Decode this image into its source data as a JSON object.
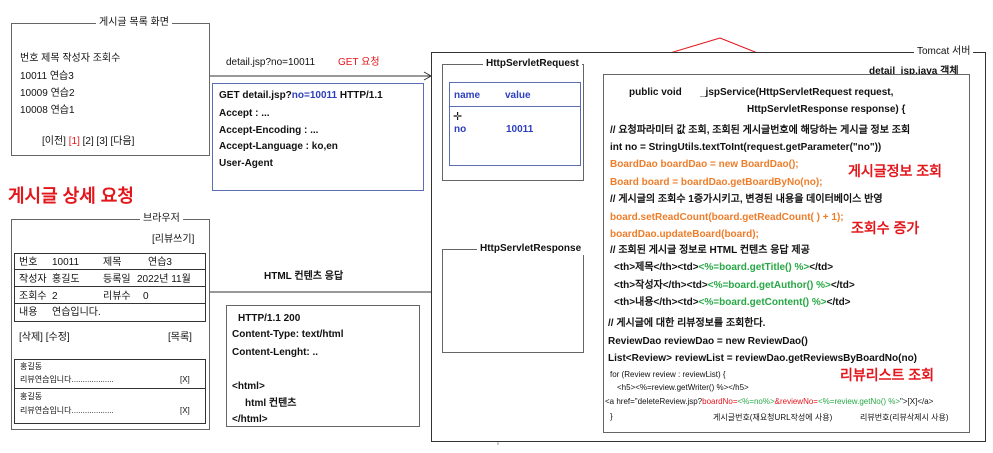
{
  "list_screen": {
    "title": "게시글 목록 화면",
    "header": "번호      제목  작성자  조회수",
    "rows": [
      "10011  연습3",
      "10009  연습2",
      "10008  연습1"
    ],
    "pager_prev": "[이전]",
    "pager_page1": "[1]",
    "pager_rest": "[2] [3] [다음]"
  },
  "request_url": "detail.jsp?no=10011",
  "get_request_label": "GET 요청",
  "detail_request_label": "게시글 상세 요청",
  "http_request_box": {
    "line1_prefix": "GET detail.jsp?",
    "line1_param": "no=10011",
    "line1_suffix": " HTTP/1.1",
    "accept": "Accept : ...",
    "accept_encoding": "Accept-Encoding : ...",
    "accept_language": "Accept-Language : ko,en",
    "user_agent": "User-Agent"
  },
  "browser": {
    "title": "브라우저",
    "write_review": "[리뷰쓰기]",
    "no_label": "번호",
    "no_value": "10011",
    "title_label": "제목",
    "title_value": "연습3",
    "writer_label": "작성자",
    "writer_value": "홍길도",
    "date_label": "등록일",
    "date_value": "2022년 11월",
    "views_label": "조회수",
    "views_value": "2",
    "reviews_label": "리뷰수",
    "reviews_value": "0",
    "content_label": "내용",
    "content_value": "연습입니다.",
    "delete_edit": "[삭제] [수정]",
    "list_link": "[목록]",
    "reviews": [
      {
        "author": "홍길동",
        "text": "리뷰연습입니다...................",
        "close": "[X]"
      },
      {
        "author": "홍길동",
        "text": "리뷰연습입니다...................",
        "close": "[X]"
      }
    ]
  },
  "html_response_label": "HTML 컨텐츠 응답",
  "http_response_box": {
    "status": "HTTP/1.1   200",
    "content_type": "Content-Type: text/html",
    "content_length": "Content-Lenght: ..",
    "html_open": "<html>",
    "html_content": "html 컨텐츠",
    "html_close": "</html>"
  },
  "tomcat": {
    "title": "Tomcat 서버",
    "object_label": "detail_jsp.java  객체"
  },
  "http_servlet_request": {
    "title": "HttpServletRequest",
    "col_name": "name",
    "col_value": "value",
    "param_name": "no",
    "param_value": "10011"
  },
  "http_servlet_response": {
    "title": "HttpServletResponse"
  },
  "code": {
    "l1a": "public void",
    "l1b": "_jspService(HttpServletRequest request,",
    "l2": "HttpServletResponse response) {",
    "c1": "// 요청파라미터 값 조회, 조회된 게시글번호에 해당하는 게시글 정보 조회",
    "l3": "int no = StringUtils.textToInt(request.getParameter(\"no\"))",
    "l4": "BoardDao boardDao = new BoardDao();",
    "l5": "Board board = boardDao.getBoardByNo(no);",
    "c2": "// 게시글의 조회수 1증가시키고, 변경된 내용을 데이터베이스 반영",
    "l6": "board.setReadCount(board.getReadCount( ) + 1);",
    "l7": "boardDao.updateBoard(board);",
    "c3": "// 조회된 게시글 정보로 HTML 컨텐츠 응답 제공",
    "th1a": "<th>제목</th><td>",
    "th1b": "<%=board.getTitle() %>",
    "th1c": "</td>",
    "th2a": "<th>작성자</th><td>",
    "th2b": "<%=board.getAuthor() %>",
    "th2c": "</td>",
    "th3a": "<th>내용</th><td>",
    "th3b": "<%=board.getContent() %>",
    "th3c": "</td>",
    "c4": "// 게시글에 대한 리뷰정보를 조회한다.",
    "l8": "ReviewDao reviewDao = new ReviewDao()",
    "l9a": "List<Review>",
    "l9b": "reviewList = reviewDao.getReviewsByBoardNo(no)",
    "l10": "for (Review review : reviewList) {",
    "l11": "<h5><%=review.getWriter() %></h5>",
    "l12a": "<a href=\"deleteReview.jsp?",
    "l12b": "boardNo=",
    "l12c": "<%=no%>",
    "l12d": "&reviewNo=",
    "l12e": "<%=review.getNo() %>",
    "l12f": "\">[X]</a>",
    "l13": "}",
    "note1": "게시글번호(재요청URL작성에 사용)",
    "note2": "리뷰번호(리뷰삭제시 사용)"
  },
  "annotations": {
    "board_lookup": "게시글정보 조회",
    "view_increase": "조회수 증가",
    "review_lookup": "리뷰리스트 조회"
  }
}
